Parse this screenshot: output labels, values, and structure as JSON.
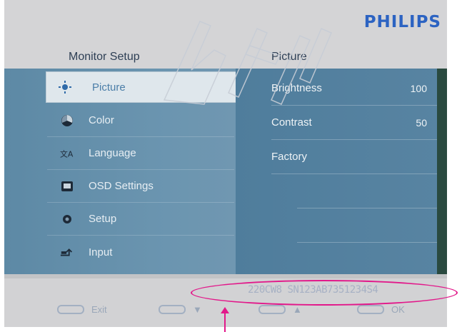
{
  "brand": "PHILIPS",
  "header": {
    "left_title": "Monitor Setup",
    "right_title": "Picture"
  },
  "menu": [
    {
      "label": "Picture",
      "icon": "picture-icon",
      "selected": true
    },
    {
      "label": "Color",
      "icon": "color-icon",
      "selected": false
    },
    {
      "label": "Language",
      "icon": "language-icon",
      "selected": false
    },
    {
      "label": "OSD Settings",
      "icon": "osd-settings-icon",
      "selected": false
    },
    {
      "label": "Setup",
      "icon": "setup-icon",
      "selected": false
    },
    {
      "label": "Input",
      "icon": "input-icon",
      "selected": false
    }
  ],
  "submenu": [
    {
      "label": "Brightness",
      "value": "100"
    },
    {
      "label": "Contrast",
      "value": "50"
    },
    {
      "label": "Factory",
      "value": ""
    }
  ],
  "footer": {
    "serial": "220CW8 SN123AB7351234S4",
    "buttons": [
      {
        "label": "Exit"
      },
      {
        "label": "▼"
      },
      {
        "label": "▲"
      },
      {
        "label": "OK"
      }
    ]
  },
  "colors": {
    "brand": "#2c63c2",
    "highlight_annotation": "#e2188a",
    "menu_bg": "#5d89a5",
    "submenu_bg": "#4f7d9c"
  }
}
